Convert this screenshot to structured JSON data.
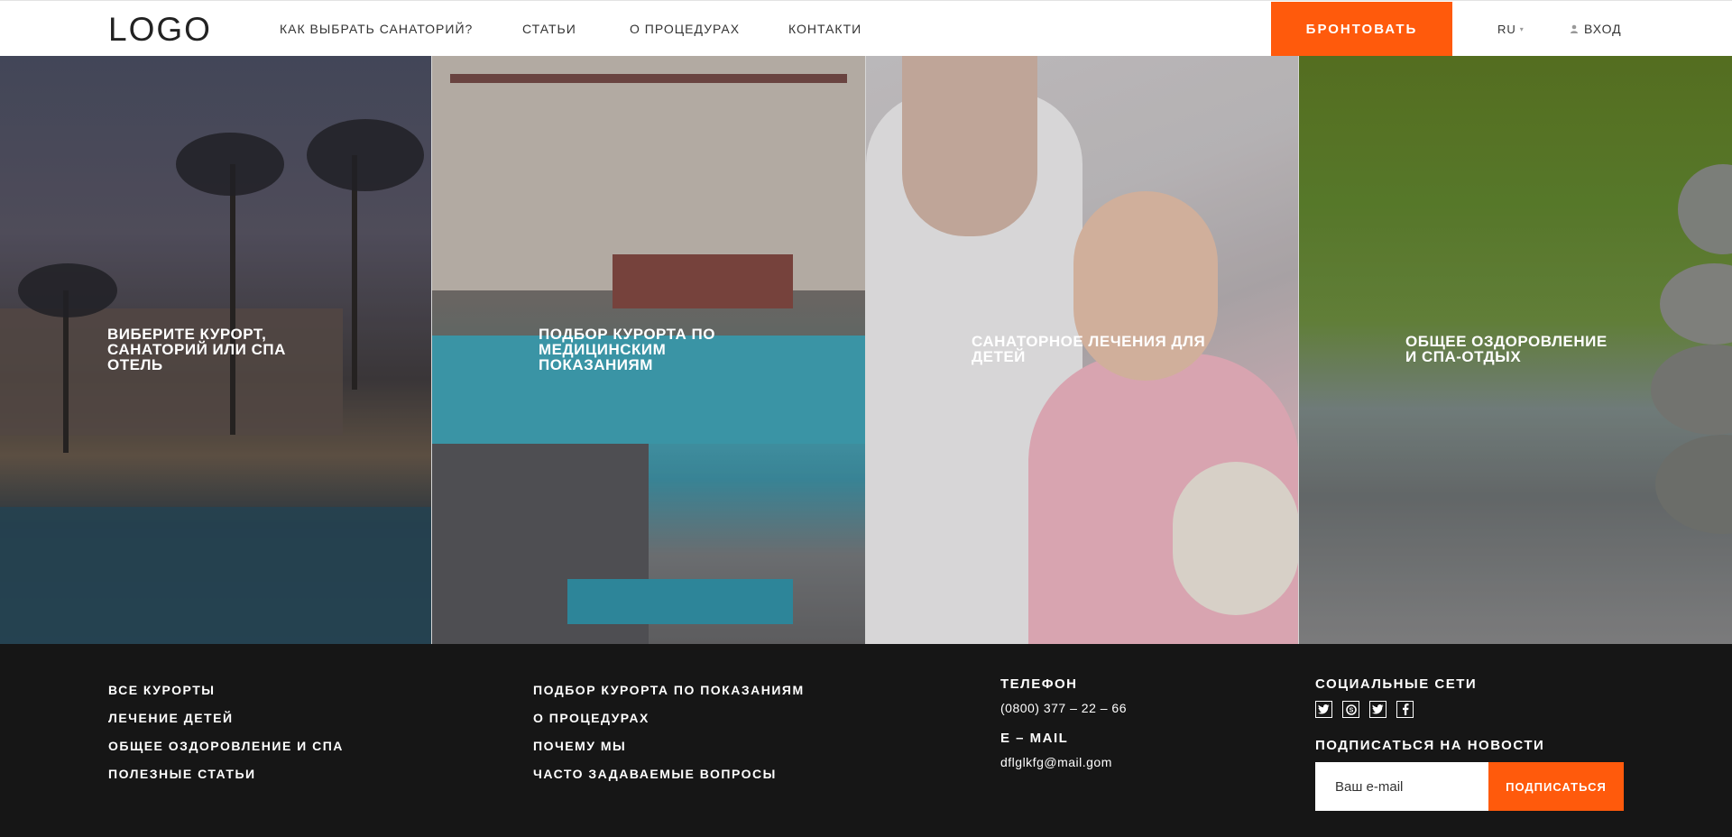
{
  "header": {
    "logo": "LOGO",
    "nav": [
      {
        "label": "КАК ВЫБРАТЬ САНАТОРИЙ?"
      },
      {
        "label": "СТАТЬИ"
      },
      {
        "label": "О ПРОЦЕДУРАХ"
      },
      {
        "label": "КОНТАКТИ"
      }
    ],
    "book_label": "БРОНТОВАТЬ",
    "lang": "RU",
    "login_label": "ВХОД"
  },
  "panels": [
    {
      "title": "ВИБЕРИТЕ КУРОРТ, САНАТОРИЙ ИЛИ СПА ОТЕЛЬ"
    },
    {
      "title": "ПОДБОР КУРОРТА ПО МЕДИЦИНСКИМ ПОКАЗАНИЯМ"
    },
    {
      "title": "САНАТОРНОЕ ЛЕЧЕНИЯ ДЛЯ ДЕТЕЙ"
    },
    {
      "title": "ОБЩЕЕ ОЗДОРОВЛЕНИЕ И СПА-ОТДЫХ"
    }
  ],
  "footer": {
    "col1": [
      "ВСЕ КУРОРТЫ",
      "ЛЕЧЕНИЕ ДЕТЕЙ",
      "ОБЩЕЕ ОЗДОРОВЛЕНИЕ И СПА",
      "ПОЛЕЗНЫЕ СТАТЬИ"
    ],
    "col2": [
      "ПОДБОР КУРОРТА ПО ПОКАЗАНИЯМ",
      "О ПРОЦЕДУРАХ",
      "ПОЧЕМУ МЫ",
      "ЧАСТО ЗАДАВАЕМЫЕ ВОПРОСЫ"
    ],
    "phone_heading": "ТЕЛЕФОН",
    "phone": "(0800) 377 – 22 – 66",
    "email_heading": "E – MAIL",
    "email": "dflglkfg@mail.gom",
    "social_heading": "СОЦИАЛЬНЫЕ СЕТИ",
    "social_icons": [
      "twitter-icon",
      "skype-icon",
      "twitter-icon",
      "facebook-icon"
    ],
    "subscribe_heading": "ПОДПИСАТЬСЯ НА НОВОСТИ",
    "email_placeholder": "Ваш e-mail",
    "subscribe_label": "ПОДПИСАТЬСЯ"
  },
  "colors": {
    "accent": "#ff5a0c",
    "footer_bg": "#161616"
  }
}
